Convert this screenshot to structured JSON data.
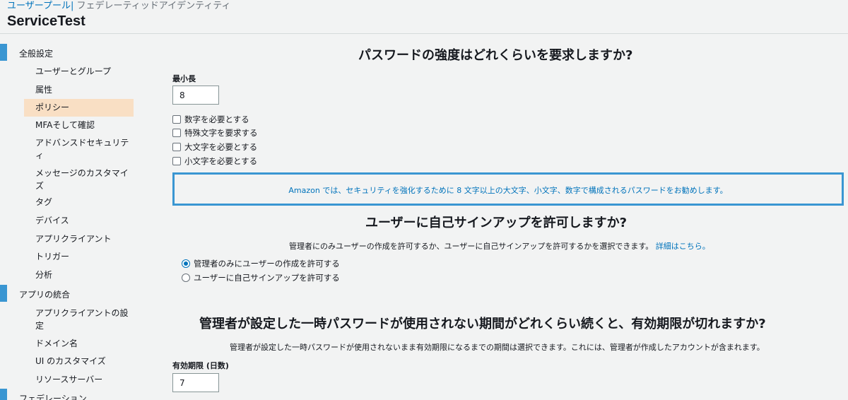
{
  "header": {
    "breadcrumb_active": "ユーザープール",
    "breadcrumb_sep": "|",
    "breadcrumb_other": "フェデレーティッドアイデンティティ",
    "title": "ServiceTest"
  },
  "sidebar": {
    "sections": [
      {
        "label": "全般設定"
      },
      {
        "label": "アプリの統合"
      },
      {
        "label": "フェデレーション"
      }
    ],
    "general_items": [
      {
        "label": "ユーザーとグループ"
      },
      {
        "label": "属性"
      },
      {
        "label": "ポリシー",
        "active": true
      },
      {
        "label": "MFAそして確認"
      },
      {
        "label": "アドバンスドセキュリティ",
        "line1": "アドバンスドセキュリテ",
        "line2": "ィ"
      },
      {
        "label": "メッセージのカスタマイズ",
        "line1": "メッセージのカスタマイ",
        "line2": "ズ"
      },
      {
        "label": "タグ"
      },
      {
        "label": "デバイス"
      },
      {
        "label": "アプリクライアント"
      },
      {
        "label": "トリガー"
      },
      {
        "label": "分析"
      }
    ],
    "app_items": [
      {
        "label": "アプリクライアントの設定",
        "line1": "アプリクライアントの設",
        "line2": "定"
      },
      {
        "label": "ドメイン名"
      },
      {
        "label": "UI のカスタマイズ"
      },
      {
        "label": "リソースサーバー"
      }
    ]
  },
  "password": {
    "heading": "パスワードの強度はどれくらいを要求しますか?",
    "min_length_label": "最小長",
    "min_length_value": "8",
    "checkboxes": [
      {
        "label": "数字を必要とする",
        "checked": false
      },
      {
        "label": "特殊文字を要求する",
        "checked": false
      },
      {
        "label": "大文字を必要とする",
        "checked": false
      },
      {
        "label": "小文字を必要とする",
        "checked": false
      }
    ],
    "notice": "Amazon では、セキュリティを強化するために 8 文字以上の大文字、小文字、数字で構成されるパスワードをお勧めします。"
  },
  "signup": {
    "heading": "ユーザーに自己サインアップを許可しますか?",
    "description": "管理者にのみユーザーの作成を許可するか、ユーザーに自己サインアップを許可するかを選択できます。",
    "details_link": "詳細はこちら。",
    "options": [
      {
        "label": "管理者のみにユーザーの作成を許可する",
        "selected": true
      },
      {
        "label": "ユーザーに自己サインアップを許可する",
        "selected": false
      }
    ]
  },
  "expiry": {
    "heading": "管理者が設定した一時パスワードが使用されない期間がどれくらい続くと、有効期限が切れますか?",
    "description": "管理者が設定した一時パスワードが使用されないまま有効期限になるまでの期間は選択できます。これには、管理者が作成したアカウントが含まれます。",
    "days_label": "有効期限 (日数)",
    "days_value": "7"
  }
}
